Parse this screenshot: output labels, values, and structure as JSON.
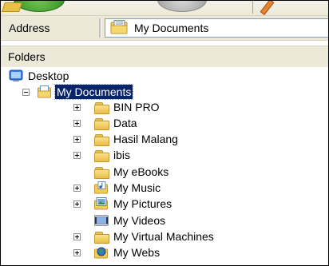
{
  "address": {
    "label": "Address",
    "value": "My Documents"
  },
  "folders_pane": {
    "title": "Folders"
  },
  "tree": {
    "root": {
      "label": "Desktop"
    },
    "selected": {
      "label": "My Documents"
    },
    "children": [
      {
        "label": "BIN PRO",
        "icon": "folder-icon"
      },
      {
        "label": "Data",
        "icon": "folder-icon"
      },
      {
        "label": "Hasil Malang",
        "icon": "folder-icon"
      },
      {
        "label": "ibis",
        "icon": "folder-icon"
      },
      {
        "label": "My eBooks",
        "icon": "folder-icon"
      },
      {
        "label": "My Music",
        "icon": "music-folder-icon"
      },
      {
        "label": "My Pictures",
        "icon": "pictures-folder-icon"
      },
      {
        "label": "My Videos",
        "icon": "videos-folder-icon"
      },
      {
        "label": "My Virtual Machines",
        "icon": "folder-icon"
      },
      {
        "label": "My Webs",
        "icon": "webs-folder-icon"
      }
    ]
  },
  "colors": {
    "selection": "#0a246a",
    "chrome": "#ece9d8",
    "folder": "#e8bf46"
  }
}
